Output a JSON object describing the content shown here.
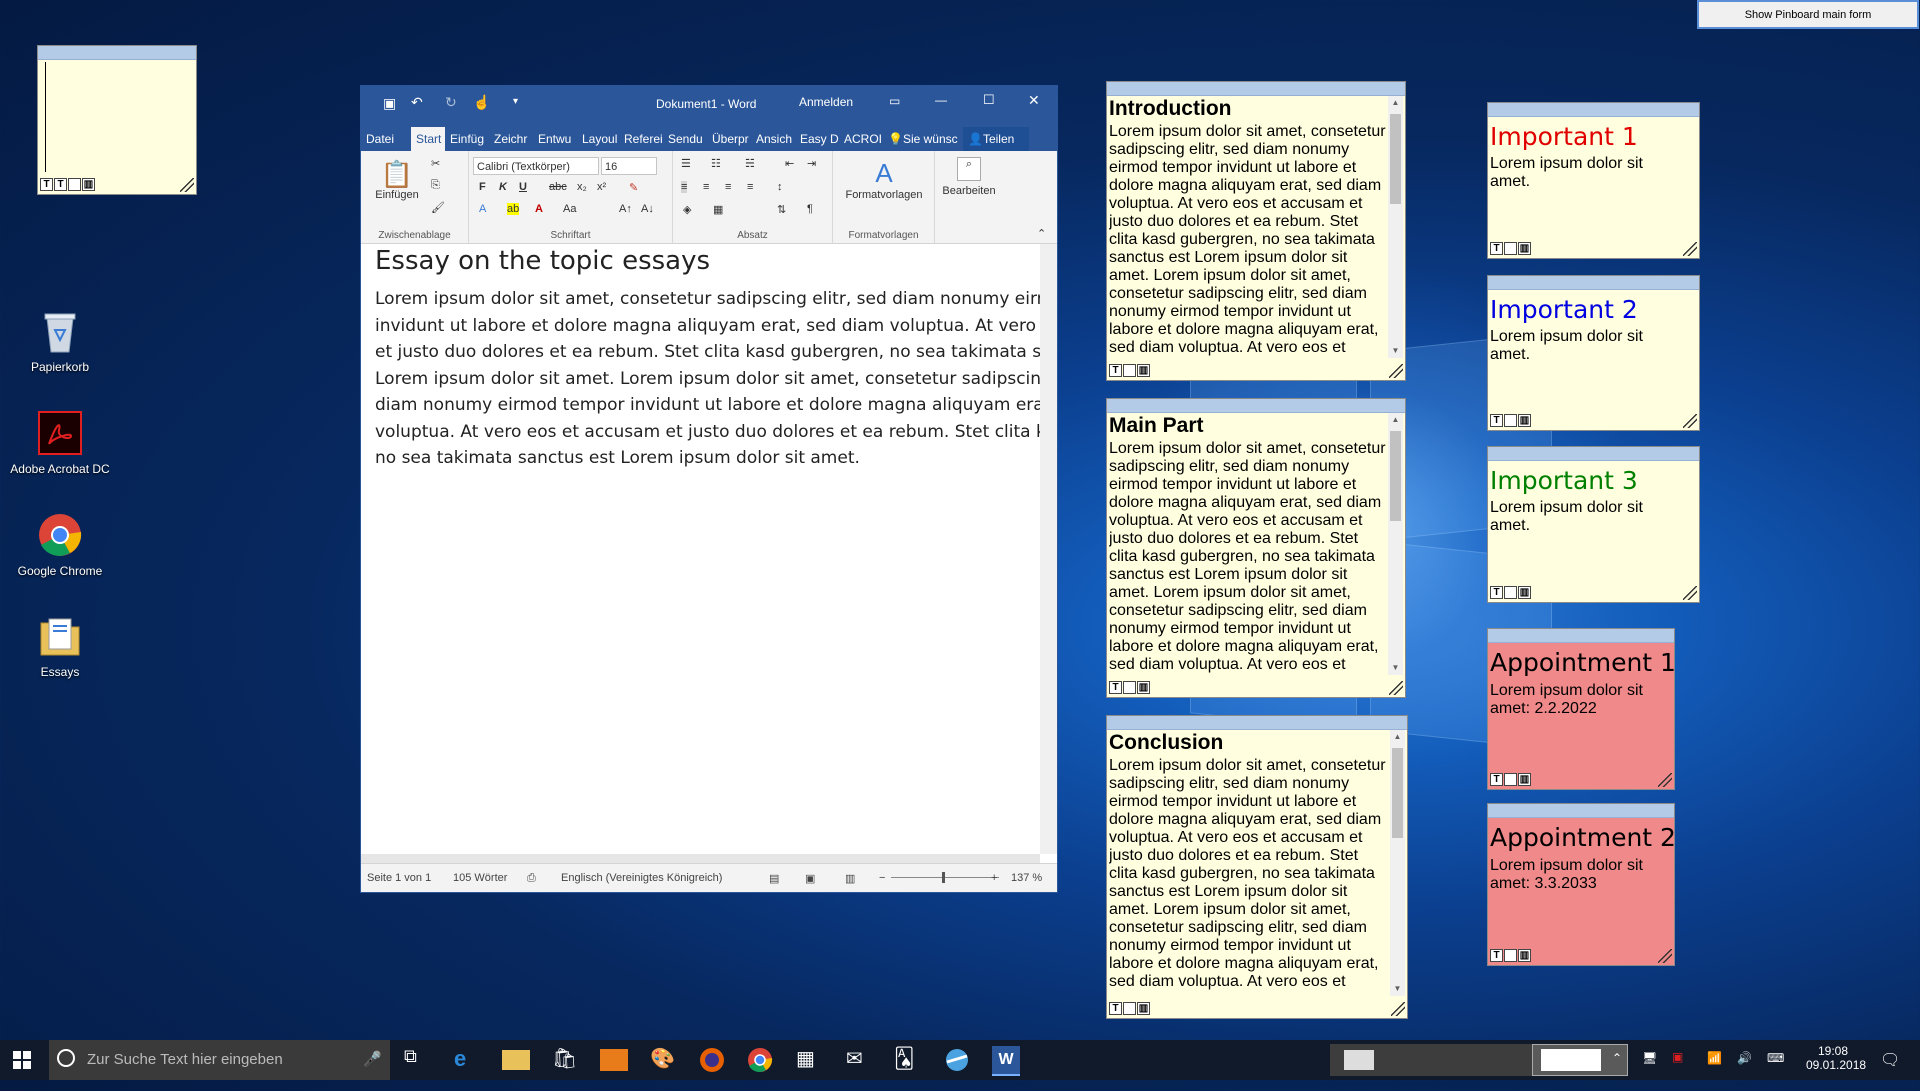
{
  "pinboard_button": "Show Pinboard main form",
  "desktop_icons": [
    {
      "label": "Papierkorb",
      "icon": "recycle-bin-icon"
    },
    {
      "label": "Adobe Acrobat DC",
      "icon": "acrobat-icon"
    },
    {
      "label": "Google Chrome",
      "icon": "chrome-icon"
    },
    {
      "label": "Essays",
      "icon": "folder-icon"
    }
  ],
  "note_tools": {
    "text_btn": "T",
    "format_btn": "",
    "delete_btn": ""
  },
  "notes_left": [
    {
      "title": "Introduction",
      "text": "Lorem ipsum dolor sit amet, consetetur sadipscing elitr, sed diam nonumy eirmod tempor invidunt ut labore et dolore magna aliquyam erat, sed diam voluptua. At vero eos et accusam et justo duo dolores et ea rebum. Stet clita kasd gubergren, no sea takimata sanctus est Lorem ipsum dolor sit amet. Lorem ipsum dolor sit amet, consetetur sadipscing elitr, sed diam nonumy eirmod tempor invidunt ut labore et dolore magna aliquyam erat, sed diam voluptua. At vero eos et accusam et justo duo dolores et ea rebum. Stet clita"
    },
    {
      "title": "Main Part",
      "text": "Lorem ipsum dolor sit amet, consetetur sadipscing elitr, sed diam nonumy eirmod tempor invidunt ut labore et dolore magna aliquyam erat, sed diam voluptua. At vero eos et accusam et justo duo dolores et ea rebum. Stet clita kasd gubergren, no sea takimata sanctus est Lorem ipsum dolor sit amet. Lorem ipsum dolor sit amet, consetetur sadipscing elitr, sed diam nonumy eirmod tempor invidunt ut labore et dolore magna aliquyam erat, sed diam voluptua. At vero eos et accusam et"
    },
    {
      "title": "Conclusion",
      "text": "Lorem ipsum dolor sit amet, consetetur sadipscing elitr, sed diam nonumy eirmod tempor invidunt ut labore et dolore magna aliquyam erat, sed diam voluptua. At vero eos et accusam et justo duo dolores et ea rebum. Stet clita kasd gubergren, no sea takimata sanctus est Lorem ipsum dolor sit amet. Lorem ipsum dolor sit amet, consetetur sadipscing elitr, sed diam nonumy eirmod tempor invidunt ut labore et dolore magna aliquyam erat, sed diam voluptua. At vero eos et accusam et"
    }
  ],
  "notes_right": [
    {
      "title": "Important 1",
      "text": "Lorem ipsum dolor sit amet.",
      "color": "#e00000"
    },
    {
      "title": "Important 2",
      "text": "Lorem ipsum dolor sit amet.",
      "color": "#0000e0"
    },
    {
      "title": "Important 3",
      "text": "Lorem ipsum dolor sit amet.",
      "color": "#008000"
    },
    {
      "title": "Appointment 1",
      "text": "Lorem ipsum dolor sit amet: 2.2.2022",
      "color": "#000000"
    },
    {
      "title": "Appointment 2",
      "text": "Lorem ipsum dolor sit amet: 3.3.2033",
      "color": "#000000"
    }
  ],
  "word": {
    "title": "Dokument1  -  Word",
    "signin": "Anmelden",
    "tabs": [
      "Datei",
      "Start",
      "Einfüg",
      "Zeichr",
      "Entwu",
      "Layoul",
      "Referei",
      "Sendu",
      "Überpr",
      "Ansich",
      "Easy D",
      "ACROI"
    ],
    "tell_me": "Sie wünsc",
    "share": "Teilen",
    "font": "Calibri (Textkörper)",
    "size": "16",
    "paste": "Einfügen",
    "styles": "Formatvorlagen",
    "edit": "Bearbeiten",
    "groups": [
      "Zwischenablage",
      "Schriftart",
      "Absatz",
      "Formatvorlagen"
    ],
    "doc_title": "Essay on the topic essays",
    "doc_text": "Lorem ipsum dolor sit amet, consetetur sadipscing elitr, sed diam nonumy eirmod tempor invidunt ut labore et dolore magna aliquyam erat, sed diam voluptua. At vero eos et accusam et justo duo dolores et ea rebum. Stet clita kasd gubergren, no sea takimata sanctus est Lorem ipsum dolor sit amet. Lorem ipsum dolor sit amet, consetetur sadipscing elitr, sed diam nonumy eirmod tempor invidunt ut labore et dolore magna aliquyam erat, sed diam voluptua. At vero eos et accusam et justo duo dolores et ea rebum. Stet clita kasd gubergren, no sea takimata sanctus est Lorem ipsum dolor sit amet.",
    "status_page": "Seite 1 von 1",
    "status_words": "105 Wörter",
    "status_lang": "Englisch (Vereinigtes Königreich)",
    "zoom": "137 %"
  },
  "taskbar": {
    "search_placeholder": "Zur Suche Text hier eingeben",
    "time": "19:08",
    "date": "09.01.2018"
  }
}
